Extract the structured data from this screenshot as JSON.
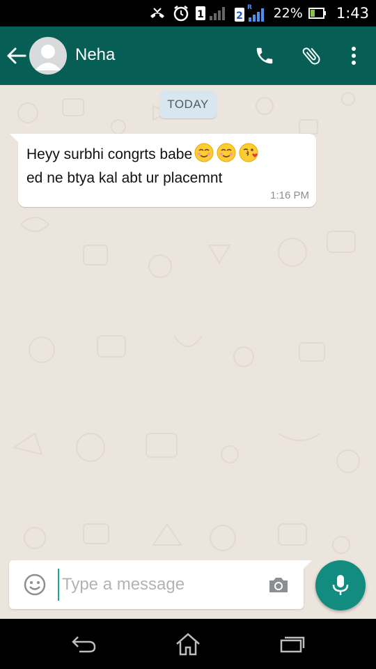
{
  "status_bar": {
    "sim1_label": "1",
    "sim2_label": "2",
    "roaming_label": "R",
    "battery": "22%",
    "time": "1:43"
  },
  "header": {
    "contact_name": "Neha",
    "icons": [
      "back-arrow-icon",
      "avatar",
      "phone-icon",
      "paperclip-icon",
      "more-vert-icon"
    ]
  },
  "chat": {
    "date_label": "TODAY",
    "messages": [
      {
        "direction": "incoming",
        "line1": "Heyy surbhi  congrts babe",
        "line2": "ed ne btya kal abt ur placemnt",
        "emojis": [
          "relieved-face",
          "relieved-face",
          "kissing-face"
        ],
        "time": "1:16 PM"
      }
    ]
  },
  "composer": {
    "placeholder": "Type a message",
    "value": ""
  },
  "colors": {
    "header": "#075e54",
    "accent": "#128c7e",
    "chat_bg": "#ece5dd",
    "date_chip": "#d8e6ef"
  }
}
